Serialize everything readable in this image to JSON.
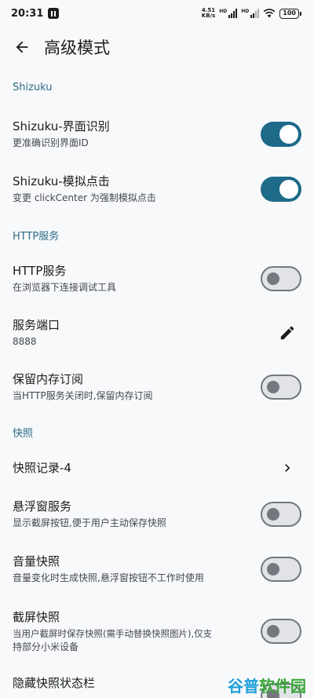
{
  "status": {
    "time": "20:31",
    "net_speed_value": "4.51",
    "net_speed_unit": "KB/s",
    "sig1_tag": "HD",
    "sig2_tag": "HD",
    "battery": "100"
  },
  "appbar": {
    "title": "高级模式"
  },
  "sections": {
    "shizuku": "Shizuku",
    "http": "HTTP服务",
    "snapshot": "快照"
  },
  "items": {
    "ui_recognition": {
      "title": "Shizuku-界面识别",
      "subtitle": "更准确识别界面ID"
    },
    "simulate_click": {
      "title": "Shizuku-模拟点击",
      "subtitle": "变更 clickCenter 为强制模拟点击"
    },
    "http_service": {
      "title": "HTTP服务",
      "subtitle": "在浏览器下连接调试工具"
    },
    "service_port": {
      "title": "服务端口",
      "subtitle": "8888"
    },
    "keep_subscription": {
      "title": "保留内存订阅",
      "subtitle": "当HTTP服务关闭时,保留内存订阅"
    },
    "snapshot_records": {
      "title": "快照记录-4"
    },
    "floating_window": {
      "title": "悬浮窗服务",
      "subtitle": "显示截屏按钮,便于用户主动保存快照"
    },
    "volume_snapshot": {
      "title": "音量快照",
      "subtitle": "音量变化时生成快照,悬浮窗按钮不工作时使用"
    },
    "screenshot_snapshot": {
      "title": "截屏快照",
      "subtitle_line1": "当用户截屏时保存快照(需手动替换快照图片),仅支",
      "subtitle_line2": "持部分小米设备"
    },
    "hide_statusbar": {
      "title": "隐藏快照状态栏"
    }
  },
  "toggles": {
    "ui_recognition": true,
    "simulate_click": true,
    "http_service": false,
    "keep_subscription": false,
    "floating_window": false,
    "volume_snapshot": false,
    "screenshot_snapshot": false,
    "hide_statusbar": false
  },
  "watermark": {
    "part1": "谷普",
    "part2": "软件园"
  },
  "colors": {
    "accent": "#1d6a89",
    "section": "#2f6a86",
    "background": "#f7f9fb"
  },
  "icons": {
    "back": "arrow-back-icon",
    "edit": "pencil-icon",
    "chevron": "chevron-right-icon"
  }
}
